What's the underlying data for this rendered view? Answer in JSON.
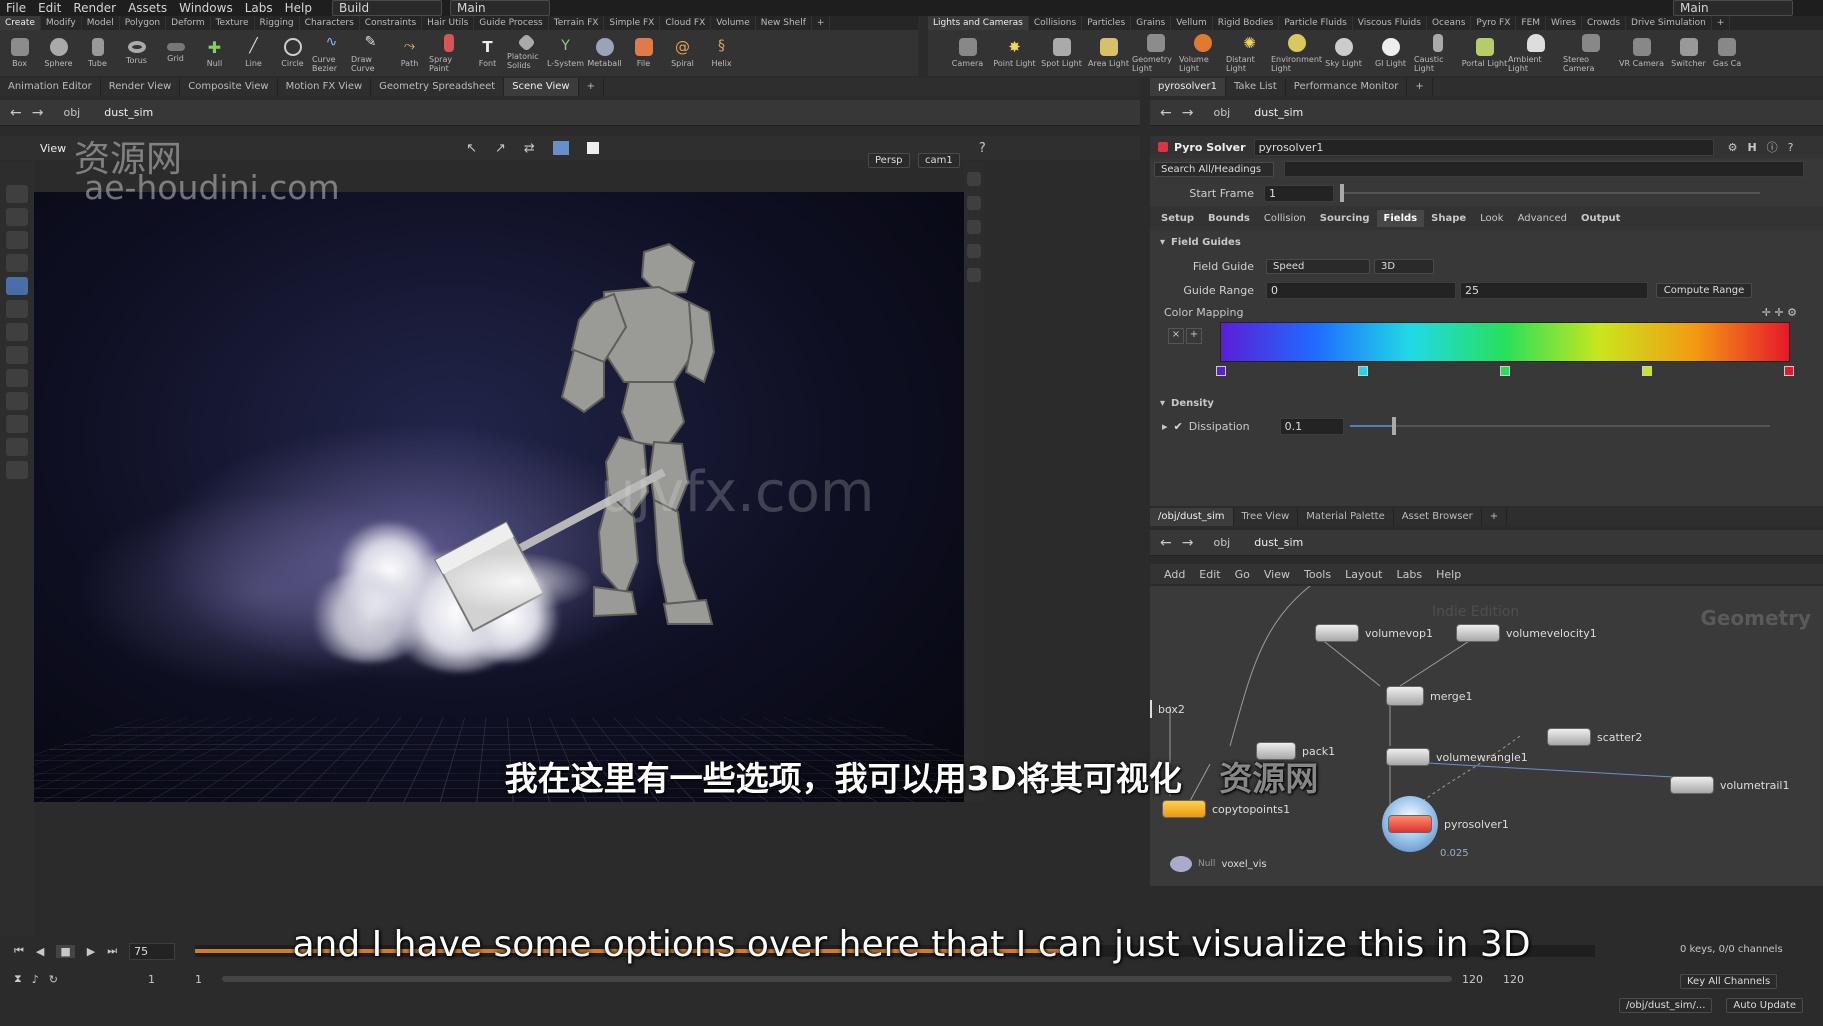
{
  "menubar": {
    "items": [
      "File",
      "Edit",
      "Render",
      "Assets",
      "Windows",
      "Labs",
      "Help"
    ],
    "desktop_left": "Build",
    "desktop_main": "Main",
    "right_desktop": "Main"
  },
  "shelf_left": {
    "tabs": [
      "Create",
      "Modify",
      "Model",
      "Polygon",
      "Deform",
      "Texture",
      "Rigging",
      "Characters",
      "Constraints",
      "Hair Utils",
      "Guide Process",
      "Terrain FX",
      "Simple FX",
      "Cloud FX",
      "Volume",
      "New Shelf"
    ],
    "tools": [
      "Box",
      "Sphere",
      "Tube",
      "Torus",
      "Grid",
      "Null",
      "Line",
      "Circle",
      "Curve Bezier",
      "Draw Curve",
      "Path",
      "Spray Paint",
      "Font",
      "Platonic Solids",
      "L-System",
      "Metaball",
      "File",
      "Spiral",
      "Helix"
    ]
  },
  "shelf_right": {
    "tabs": [
      "Lights and Cameras",
      "Collisions",
      "Particles",
      "Grains",
      "Vellum",
      "Rigid Bodies",
      "Particle Fluids",
      "Viscous Fluids",
      "Oceans",
      "Pyro FX",
      "FEM",
      "Wires",
      "Crowds",
      "Drive Simulation"
    ],
    "tools": [
      "Camera",
      "Point Light",
      "Spot Light",
      "Area Light",
      "Geometry Light",
      "Volume Light",
      "Distant Light",
      "Environment Light",
      "Sky Light",
      "GI Light",
      "Caustic Light",
      "Portal Light",
      "Ambient Light",
      "Stereo Camera",
      "VR Camera",
      "Switcher",
      "Gas Ca"
    ]
  },
  "left_pane": {
    "tabs": [
      "Animation Editor",
      "Render View",
      "Composite View",
      "Motion FX View",
      "Geometry Spreadsheet",
      "Scene View"
    ],
    "path_obj": "obj",
    "path_node": "dust_sim",
    "view_label": "View",
    "persp": "Persp",
    "cam": "cam1"
  },
  "param_pane": {
    "tabs": [
      "pyrosolver1",
      "Take List",
      "Performance Monitor"
    ],
    "path_obj": "obj",
    "path_node": "dust_sim",
    "node_type": "Pyro Solver",
    "node_name": "pyrosolver1",
    "search": "Search All/Headings",
    "start_frame_label": "Start Frame",
    "start_frame": "1",
    "subtabs": [
      "Setup",
      "Bounds",
      "Collision",
      "Sourcing",
      "Fields",
      "Shape",
      "Look",
      "Advanced",
      "Output"
    ],
    "field_guides_heading": "Field Guides",
    "field_guide_label": "Field Guide",
    "field_guide_value": "Speed",
    "field_guide_mode": "3D",
    "guide_range_label": "Guide Range",
    "guide_range_min": "0",
    "guide_range_max": "25",
    "compute_range": "Compute Range",
    "color_mapping_label": "Color Mapping",
    "ramp_colors": [
      "#5a1fd6",
      "#1f6cff",
      "#21d9e6",
      "#27e05a",
      "#c9e61d",
      "#f29b12",
      "#e6182a"
    ],
    "density_heading": "Density",
    "dissipation_label": "Dissipation",
    "dissipation": "0.1",
    "dissipation_fraction": 0.1
  },
  "network_pane": {
    "tabs": [
      "/obj/dust_sim",
      "Tree View",
      "Material Palette",
      "Asset Browser"
    ],
    "path_obj": "obj",
    "path_node": "dust_sim",
    "menu": [
      "Add",
      "Edit",
      "Go",
      "View",
      "Tools",
      "Layout",
      "Labs",
      "Help"
    ],
    "context_label": "Geometry",
    "edition": "Indie Edition",
    "nodes": [
      "volumevop1",
      "volumevelocity1",
      "merge1",
      "scatter2",
      "box2",
      "pack1",
      "volumewrangle1",
      "copytopoints1",
      "pyrosolver1",
      "volumetrail1",
      "voxel_vis"
    ],
    "node_small_note": "0.025",
    "null_label": "Null"
  },
  "timeline": {
    "frame": "75",
    "start": "1",
    "start2": "1",
    "end": "120",
    "end2": "120",
    "current_fraction": 0.62,
    "keys": "0 keys, 0/0 channels",
    "key_all": "Key All Channels",
    "status_path": "/obj/dust_sim/...",
    "auto_update": "Auto Update"
  },
  "watermarks": {
    "cn": "资源网",
    "site": "ae-houdini.com",
    "center": "ujvfx.com"
  },
  "subtitles": {
    "cn": "我在这里有一些选项，我可以用3D将其可视化",
    "cn_wm": "资源网",
    "en": "and I have some options over here that I can just visualize this in 3D"
  }
}
